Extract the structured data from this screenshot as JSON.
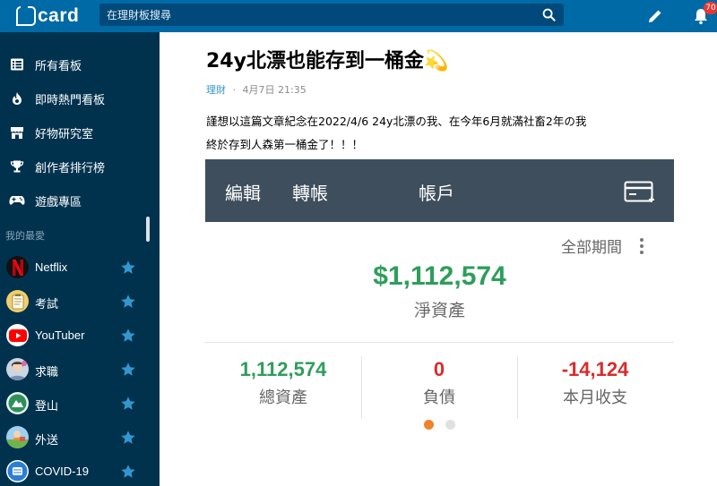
{
  "header": {
    "logo_text": "card",
    "search_placeholder": "在理財板搜尋",
    "notification_count": "70"
  },
  "sidebar": {
    "nav": [
      {
        "label": "所有看板",
        "icon": "list-icon"
      },
      {
        "label": "即時熱門看板",
        "icon": "flame-icon"
      },
      {
        "label": "好物研究室",
        "icon": "shop-icon"
      },
      {
        "label": "創作者排行榜",
        "icon": "trophy-icon"
      },
      {
        "label": "遊戲專區",
        "icon": "gamepad-icon"
      }
    ],
    "favorites_label": "我的最愛",
    "favorites": [
      {
        "label": "Netflix",
        "icon": "netflix-logo-icon",
        "color": "#d81f26"
      },
      {
        "label": "考試",
        "icon": "notepad-icon",
        "color": "#f2cf6b"
      },
      {
        "label": "YouTuber",
        "icon": "youtube-logo-icon",
        "color": "#ff0000"
      },
      {
        "label": "求職",
        "icon": "job-avatar-icon",
        "color": "#9fb3c8"
      },
      {
        "label": "登山",
        "icon": "hiking-icon",
        "color": "#2f8f5b"
      },
      {
        "label": "外送",
        "icon": "delivery-icon",
        "color": "#4aa3df"
      },
      {
        "label": "COVID-19",
        "icon": "covid-icon",
        "color": "#2a7fd4"
      }
    ]
  },
  "post": {
    "title": "24y北漂也能存到一桶金💫",
    "board": "理財",
    "separator": "·",
    "date": "4月7日 21:35",
    "lines": [
      "謹想以這篇文章紀念在2022/4/6 24y北漂の我、在今年6月就滿社畜2年の我",
      "終於存到人森第一桶金了！！！"
    ]
  },
  "screenshot": {
    "tabs": [
      "編輯",
      "轉帳",
      "帳戶"
    ],
    "period": "全部期間",
    "net_value": "$1,112,574",
    "net_label": "淨資產",
    "stats": [
      {
        "value": "1,112,574",
        "label": "總資產",
        "color": "#2e9e5b"
      },
      {
        "value": "0",
        "label": "負債",
        "color": "#d92b2b"
      },
      {
        "value": "-14,124",
        "label": "本月收支",
        "color": "#d92b2b"
      }
    ],
    "colors": {
      "bar": "#3e4e5c",
      "dot_active": "#f0832a",
      "dot_inactive": "#e0e0e0"
    }
  },
  "colors": {
    "header": "#006aa6",
    "sidebar": "#00324e",
    "star": "#3397cf"
  }
}
